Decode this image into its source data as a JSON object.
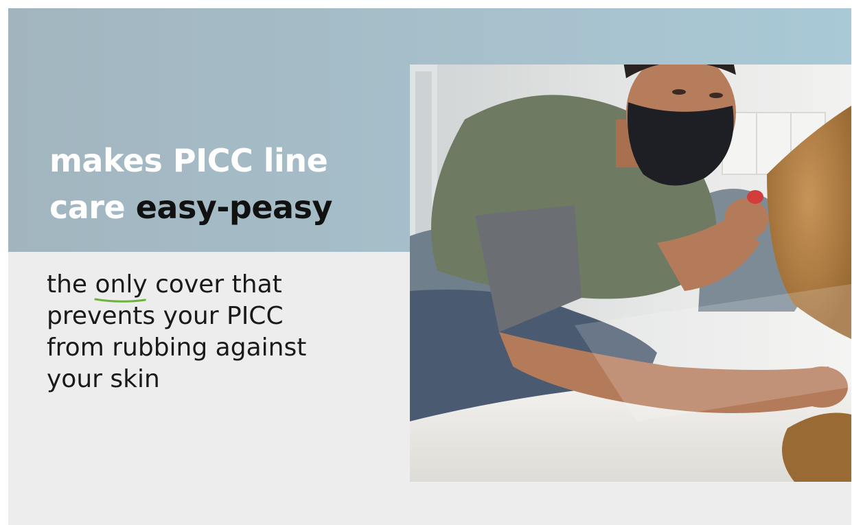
{
  "headline": {
    "line1": "makes PICC line",
    "line2_prefix": "care ",
    "line2_emphasis": "easy-peasy"
  },
  "subtext": {
    "line1_prefix": "the ",
    "line1_underlined": "only",
    "line1_suffix": " cover that",
    "line2": "prevents your PICC",
    "line3": "from rubbing against",
    "line4": "your skin"
  },
  "colors": {
    "band": "#a6bfca",
    "panel": "#ededed",
    "underline": "#6ab43a",
    "headline": "#ffffff",
    "headline_emphasis": "#111111"
  },
  "photo": {
    "subject": "man-with-arm-sleeve-and-dog-photo"
  }
}
